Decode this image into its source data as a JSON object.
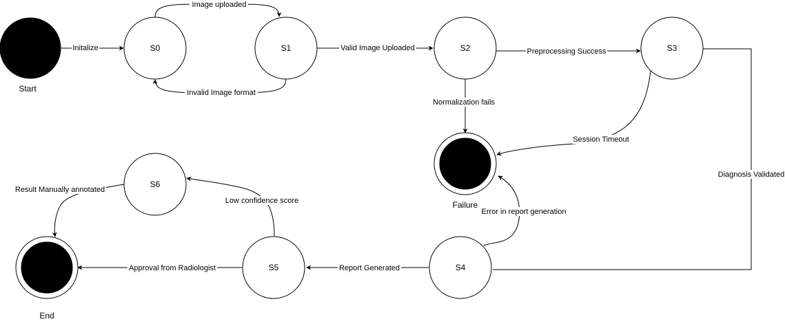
{
  "diagram": {
    "states": {
      "start": "Start",
      "s0": "S0",
      "s1": "S1",
      "s2": "S2",
      "s3": "S3",
      "s4": "S4",
      "s5": "S5",
      "s6": "S6",
      "failure": "Failure",
      "end": "End"
    },
    "transitions": {
      "initialize": "Initalize",
      "image_uploaded": "Image uploaded",
      "invalid_image_format": "Invalid Image format",
      "valid_image_uploaded": "Valid Image Uploaded",
      "preprocessing_success": "Preprocessing Success",
      "normalization_fails": "Normalization fails",
      "session_timeout": "Session Timeout",
      "diagnosis_validated": "Diagnosis Validated",
      "error_in_report_generation": "Error in report generation",
      "report_generated": "Report Generated",
      "approval_from_radiologist": "Approval from Radiologist",
      "low_confidence_score": "Low confidence score",
      "result_manually_annotated": "Result Manually annotated"
    },
    "colors": {
      "stroke": "#000000",
      "terminal_fill": "#000000",
      "background": "#ffffff"
    }
  }
}
